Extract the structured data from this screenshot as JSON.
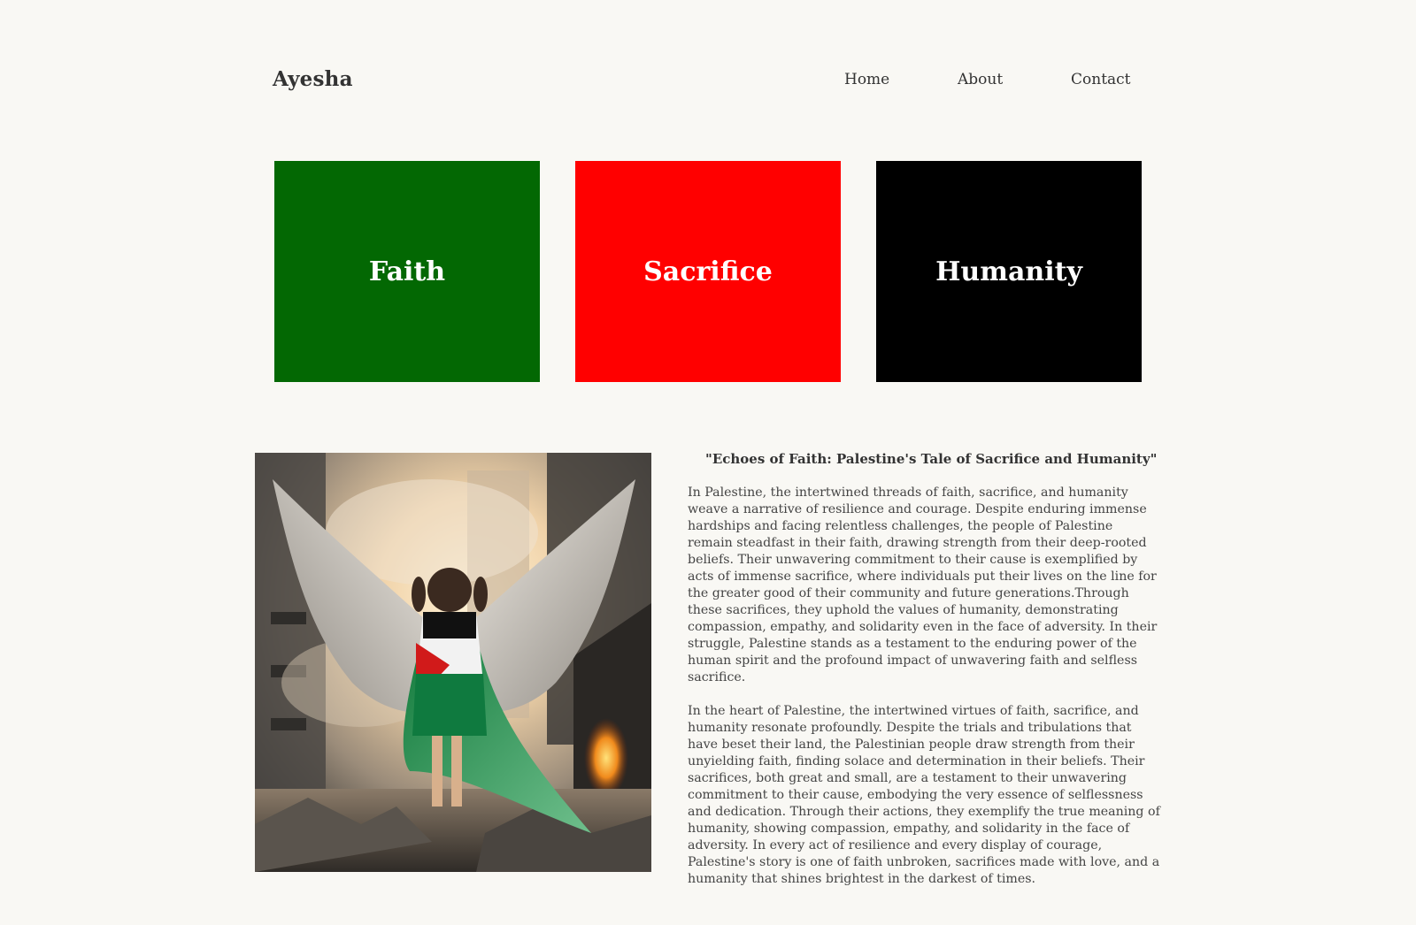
{
  "brand": {
    "name": "Ayesha"
  },
  "nav": {
    "home": "Home",
    "about": "About",
    "contact": "Contact"
  },
  "cards": [
    {
      "label": "Faith",
      "color": "#036803"
    },
    {
      "label": "Sacrifice",
      "color": "#ff0000"
    },
    {
      "label": "Humanity",
      "color": "#000000"
    }
  ],
  "article": {
    "title": "\"Echoes of Faith: Palestine's Tale of Sacrifice and Humanity\"",
    "paragraphs": [
      "In Palestine, the intertwined threads of faith, sacrifice, and humanity weave a narrative of resilience and courage. Despite enduring immense hardships and facing relentless challenges, the people of Palestine remain steadfast in their faith, drawing strength from their deep-rooted beliefs. Their unwavering commitment to their cause is exemplified by acts of immense sacrifice, where individuals put their lives on the line for the greater good of their community and future generations.Through these sacrifices, they uphold the values of humanity, demonstrating compassion, empathy, and solidarity even in the face of adversity. In their struggle, Palestine stands as a testament to the enduring power of the human spirit and the profound impact of unwavering faith and selfless sacrifice.",
      "In the heart of Palestine, the intertwined virtues of faith, sacrifice, and humanity resonate profoundly. Despite the trials and tribulations that have beset their land, the Palestinian people draw strength from their unyielding faith, finding solace and determination in their beliefs. Their sacrifices, both great and small, are a testament to their unwavering commitment to their cause, embodying the very essence of selflessness and dedication. Through their actions, they exemplify the true meaning of humanity, showing compassion, empathy, and solidarity in the face of adversity. In every act of resilience and every display of courage, Palestine's story is one of faith unbroken, sacrifices made with love, and a humanity that shines brightest in the darkest of times."
    ]
  },
  "colors": {
    "background": "#f9f8f4",
    "text": "#333333",
    "flag_black": "#111111",
    "flag_white": "#f2f2f2",
    "flag_green": "#0f7a3f",
    "flag_red": "#d11a1a"
  }
}
